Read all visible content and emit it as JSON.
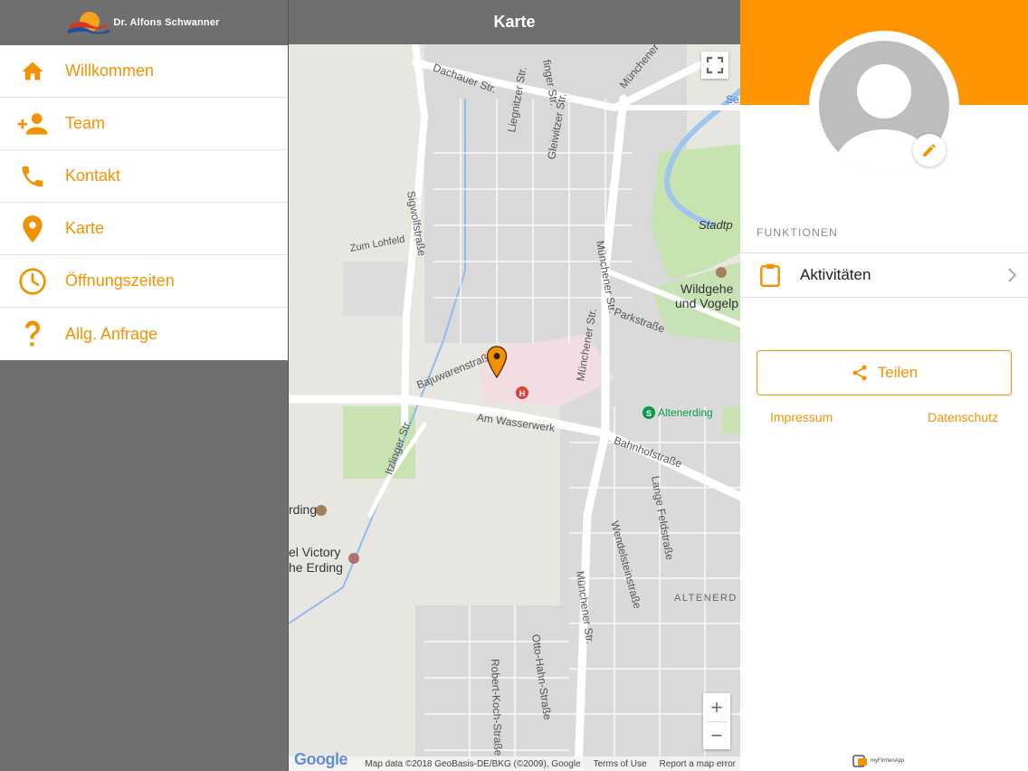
{
  "sidebar": {
    "brand": "Dr. Alfons Schwanner",
    "items": [
      {
        "label": "Willkommen",
        "icon": "home-icon"
      },
      {
        "label": "Team",
        "icon": "add-person-icon"
      },
      {
        "label": "Kontakt",
        "icon": "phone-icon"
      },
      {
        "label": "Karte",
        "icon": "location-pin-icon"
      },
      {
        "label": "Öffnungszeiten",
        "icon": "clock-icon"
      },
      {
        "label": "Allg. Anfrage",
        "icon": "question-icon"
      }
    ]
  },
  "map_panel": {
    "title": "Karte",
    "labels": {
      "dachauer": "Dachauer Str.",
      "finger": "finger Str.",
      "muenchener_top": "Münchener Str.",
      "liegnitzer": "Liegnitzer Str.",
      "gleiwitzer": "Gleiwitzer Str.",
      "sigwolf": "Sigwolfstraße",
      "lohfeld": "Zum Lohfeld",
      "muenchener_mid": "Münchener Str.",
      "park": "Parkstraße",
      "stadtp": "Stadtp",
      "wildgehe": "Wildgehe",
      "vogel": "und Vogelp",
      "bajuwaren": "Bajuwarenstraße",
      "muenchener_low": "Münchener Str.",
      "altenerding_station": "Altenerding",
      "wasserwerk": "Am Wasserwerk",
      "bahnhof": "Bahnhofstraße",
      "itzlinger": "Itzlinger Str.",
      "lange_feld": "Lange Feldstraße",
      "wendelstein": "Wendelsteinstraße",
      "erding": "rding",
      "victory": "el Victory",
      "he_erding": "he Erding",
      "altenerd": "ALTENERD",
      "muenchener_bottom": "Münchener Str.",
      "robert_koch": "Robert-Koch-Straße",
      "otto_hahn": "Otto-Hahn-Straße",
      "se": "Se"
    },
    "zoom_in": "+",
    "zoom_out": "−",
    "google": "Google",
    "attribution": "Map data ©2018 GeoBasis-DE/BKG (©2009), Google",
    "terms": "Terms of Use",
    "report": "Report a map error"
  },
  "profile_panel": {
    "section_title": "FUNKTIONEN",
    "activity_label": "Aktivitäten",
    "share_label": "Teilen",
    "impressum": "Impressum",
    "datenschutz": "Datenschutz",
    "footer_brand": "myFirmenApp"
  },
  "colors": {
    "accent": "#f39200",
    "band": "#ff9500",
    "header_gray": "#6f6f6f"
  }
}
